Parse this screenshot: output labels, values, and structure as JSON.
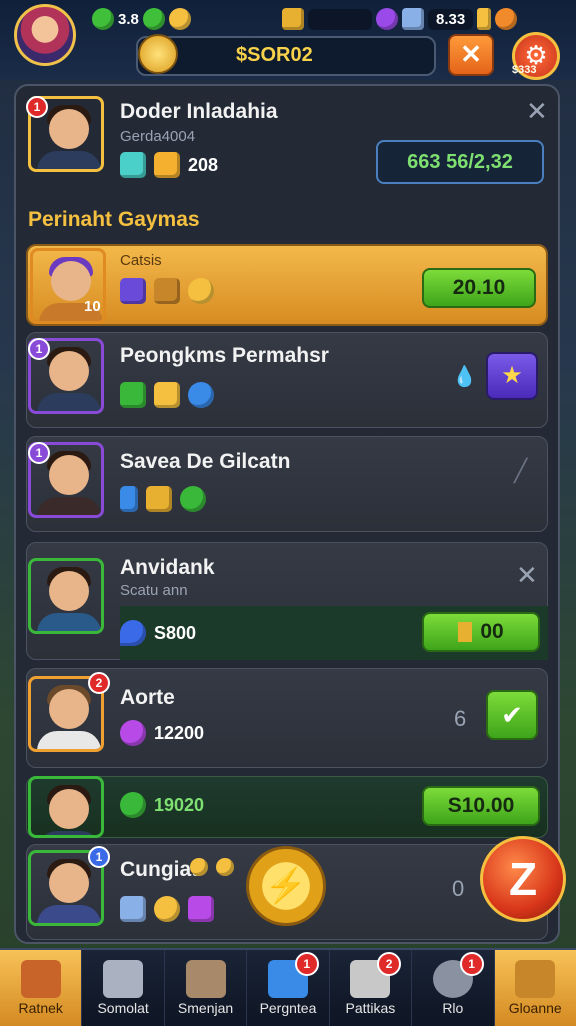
{
  "topbar": {
    "currency_1": "3.8",
    "currency_2": "8.33"
  },
  "search": {
    "value": "$SOR02"
  },
  "gear_label": "$333",
  "profile": {
    "badge": "1",
    "name": "Doder Inladahia",
    "subtitle": "Gerda4004",
    "count": "208",
    "readout": "663 56/2,32"
  },
  "section_label": "Perinaht Gaymas",
  "items": [
    {
      "badge": "",
      "title": "",
      "subtitle": "Catsis",
      "portrait_tag": "10",
      "button": "20.10"
    },
    {
      "badge": "1",
      "title": "Peongkms Permahsr",
      "subtitle": "",
      "side_count": ""
    },
    {
      "badge": "1",
      "title": "Savea De Gilcatn",
      "subtitle": ""
    },
    {
      "badge": "",
      "title": "Anvidank",
      "subtitle": "Scatu ann",
      "count": "S800",
      "button": "00"
    },
    {
      "badge": "2",
      "title": "Aorte",
      "count": "12200",
      "side_count": "6"
    },
    {
      "badge": "",
      "count": "19020",
      "button": "S10.00"
    },
    {
      "badge": "1",
      "title": "Cungiat",
      "side_count": "0",
      "big_red": "Z"
    }
  ],
  "nav": [
    {
      "label": "Ratnek",
      "badge": "",
      "active": true
    },
    {
      "label": "Somolat",
      "badge": ""
    },
    {
      "label": "Smenjan",
      "badge": ""
    },
    {
      "label": "Pergntea",
      "badge": "1"
    },
    {
      "label": "Pattikas",
      "badge": "2"
    },
    {
      "label": "Rlo",
      "badge": "1"
    },
    {
      "label": "Gloanne",
      "badge": "",
      "active": true
    }
  ],
  "colors": {
    "accent": "#f5c040",
    "green": "#5cc22a",
    "panel": "#232a36"
  }
}
